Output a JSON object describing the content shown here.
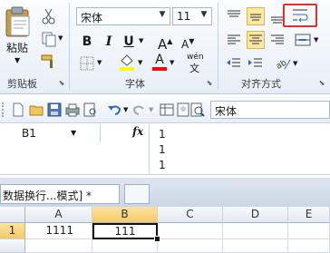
{
  "ribbon": {
    "clipboard": {
      "paste_label": "粘贴",
      "group_label": "剪贴板"
    },
    "font": {
      "name": "宋体",
      "size": "11",
      "group_label": "字体",
      "bold": "B",
      "italic": "I",
      "underline": "U",
      "grow": "A",
      "shrink": "A",
      "fill_color": "#ffff00",
      "font_color": "#ff0000",
      "phonetic": "wén"
    },
    "alignment": {
      "group_label": "对齐方式"
    }
  },
  "toolbar": {
    "font_name": "宋体"
  },
  "formula_bar": {
    "name_box": "B1",
    "fx_label": "fx",
    "content_lines": [
      "1",
      "1",
      "1"
    ]
  },
  "tabs": [
    {
      "label": "数据换行...模式] *"
    }
  ],
  "grid": {
    "columns": [
      "A",
      "B",
      "C",
      "D",
      "E"
    ],
    "rows": [
      {
        "header": "1",
        "cells": [
          "1111",
          "111",
          "",
          "",
          ""
        ]
      }
    ]
  },
  "highlight_color": "#e0312a"
}
